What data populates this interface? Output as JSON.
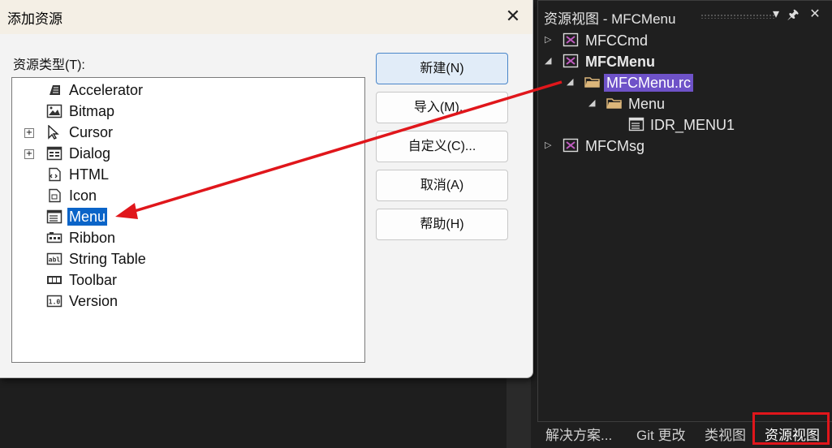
{
  "dialog": {
    "title": "添加资源",
    "close": "✕",
    "type_label": "资源类型(T):",
    "resources": [
      {
        "label": "Accelerator",
        "expandable": false,
        "icon": "accelerator-icon"
      },
      {
        "label": "Bitmap",
        "expandable": false,
        "icon": "bitmap-icon"
      },
      {
        "label": "Cursor",
        "expandable": true,
        "icon": "cursor-icon"
      },
      {
        "label": "Dialog",
        "expandable": true,
        "icon": "dialog-icon"
      },
      {
        "label": "HTML",
        "expandable": false,
        "icon": "html-icon"
      },
      {
        "label": "Icon",
        "expandable": false,
        "icon": "icon-resource-icon"
      },
      {
        "label": "Menu",
        "expandable": false,
        "icon": "menu-icon",
        "selected": true
      },
      {
        "label": "Ribbon",
        "expandable": false,
        "icon": "ribbon-icon"
      },
      {
        "label": "String Table",
        "expandable": false,
        "icon": "string-table-icon"
      },
      {
        "label": "Toolbar",
        "expandable": false,
        "icon": "toolbar-icon"
      },
      {
        "label": "Version",
        "expandable": false,
        "icon": "version-icon"
      }
    ],
    "buttons": {
      "new": "新建(N)",
      "import": "导入(M)...",
      "custom": "自定义(C)...",
      "cancel": "取消(A)",
      "help": "帮助(H)"
    }
  },
  "panel": {
    "title": "资源视图 - MFCMenu",
    "pin": "🖈",
    "close": "✕",
    "dropdown": "▾",
    "tree": [
      {
        "label": "MFCCmd",
        "arrow": "▷",
        "icon": "project-icon",
        "bold": false
      },
      {
        "label": "MFCMenu",
        "arrow": "◢",
        "icon": "project-icon",
        "bold": true
      },
      {
        "label": "MFCMenu.rc",
        "arrow": "◢",
        "icon": "folder-open-icon",
        "highlight": true
      },
      {
        "label": "Menu",
        "arrow": "◢",
        "icon": "folder-open-icon"
      },
      {
        "label": "IDR_MENU1",
        "arrow": "",
        "icon": "menu-resource-icon"
      },
      {
        "label": "MFCMsg",
        "arrow": "▷",
        "icon": "project-icon",
        "bold": false
      }
    ]
  },
  "tabs": {
    "solution": "解决方案...",
    "git": "Git 更改",
    "class": "类视图",
    "resource": "资源视图"
  },
  "colors": {
    "selection": "#0a64c8",
    "highlight": "#6e52c8",
    "arrow": "#e0161b"
  }
}
